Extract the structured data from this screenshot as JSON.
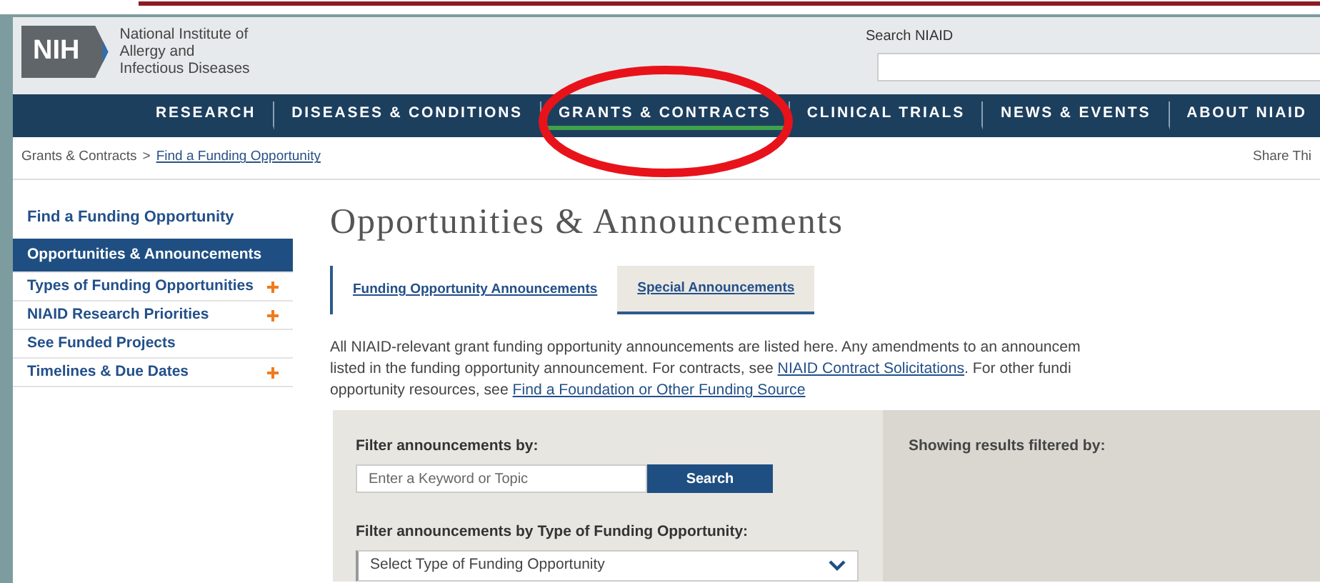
{
  "header": {
    "logo": "NIH",
    "org_name_lines": [
      "National Institute of",
      "Allergy and",
      "Infectious Diseases"
    ],
    "search": {
      "label": "Search NIAID"
    }
  },
  "nav": [
    {
      "label": "RESEARCH",
      "selected": false
    },
    {
      "label": "DISEASES & CONDITIONS",
      "selected": false
    },
    {
      "label": "GRANTS & CONTRACTS",
      "selected": true
    },
    {
      "label": "CLINICAL TRIALS",
      "selected": false
    },
    {
      "label": "NEWS & EVENTS",
      "selected": false
    },
    {
      "label": "ABOUT NIAID",
      "selected": false
    }
  ],
  "breadcrumb": {
    "parent": "Grants & Contracts",
    "separator": ">",
    "current": "Find a Funding Opportunity"
  },
  "share": "Share Thi",
  "sidebar": {
    "heading": "Find a Funding Opportunity",
    "items": [
      {
        "label": "Opportunities & Announcements",
        "selected": true,
        "expandable": false
      },
      {
        "label": "Types of Funding Opportunities",
        "selected": false,
        "expandable": true
      },
      {
        "label": "NIAID Research Priorities",
        "selected": false,
        "expandable": true
      },
      {
        "label": "See Funded Projects",
        "selected": false,
        "expandable": false
      },
      {
        "label": "Timelines & Due Dates",
        "selected": false,
        "expandable": true
      }
    ]
  },
  "page_title": "Opportunities & Announcements",
  "tabs": [
    {
      "label": "Funding Opportunity Announcements",
      "selected": true
    },
    {
      "label": "Special Announcements",
      "selected": false
    }
  ],
  "intro": [
    [
      {
        "kind": "text",
        "text": "All NIAID-relevant grant funding opportunity announcements are listed here. Any amendments to an announcem"
      }
    ],
    [
      {
        "kind": "text",
        "text": "listed in the funding opportunity announcement. For contracts, see "
      },
      {
        "kind": "link",
        "text": "NIAID Contract Solicitations"
      },
      {
        "kind": "text",
        "text": ". For other fundi"
      }
    ],
    [
      {
        "kind": "text",
        "text": "opportunity resources, see "
      },
      {
        "kind": "link",
        "text": "Find a Foundation or Other Funding Source"
      }
    ]
  ],
  "filter": {
    "keyword_label": "Filter announcements by:",
    "keyword_placeholder": "Enter a Keyword or Topic",
    "search_button": "Search",
    "type_label": "Filter announcements by Type of Funding Opportunity:",
    "type_select": "Select Type of Funding Opportunity",
    "results_label": "Showing results filtered by:"
  },
  "annotations": [
    {
      "kind": "ellipse",
      "color": "#e8131a"
    }
  ]
}
